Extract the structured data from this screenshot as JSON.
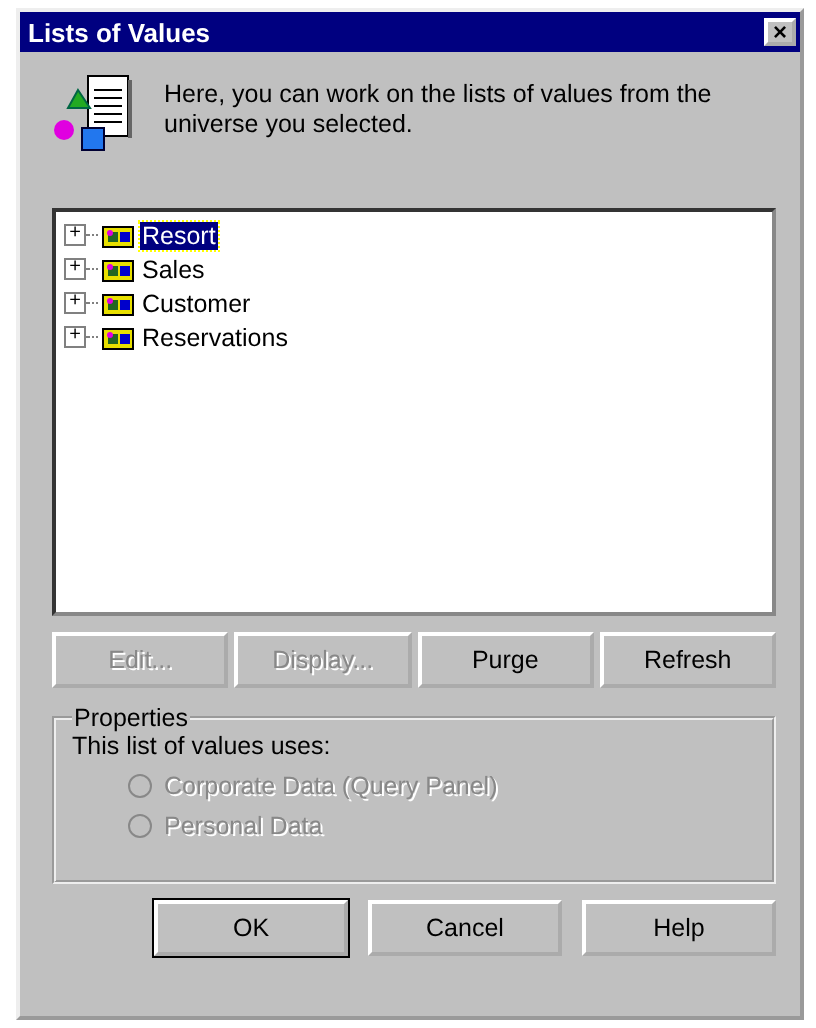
{
  "window": {
    "title": "Lists of Values",
    "close": "×"
  },
  "intro": "Here, you can work on the lists of values from the universe you selected.",
  "tree": [
    {
      "label": "Resort",
      "selected": true,
      "expanded": false,
      "toggle": "+"
    },
    {
      "label": "Sales",
      "selected": false,
      "expanded": false,
      "toggle": "+"
    },
    {
      "label": "Customer",
      "selected": false,
      "expanded": false,
      "toggle": "+"
    },
    {
      "label": "Reservations",
      "selected": false,
      "expanded": false,
      "toggle": "+"
    }
  ],
  "actions": [
    {
      "label": "Edit...",
      "disabled": true
    },
    {
      "label": "Display...",
      "disabled": true
    },
    {
      "label": "Purge",
      "disabled": false
    },
    {
      "label": "Refresh",
      "disabled": false
    }
  ],
  "properties": {
    "title": "Properties",
    "caption": "This list of values uses:",
    "options": [
      {
        "label": "Corporate Data (Query Panel)",
        "checked": false,
        "disabled": true
      },
      {
        "label": "Personal Data",
        "checked": false,
        "disabled": true
      }
    ]
  },
  "buttons": [
    {
      "label": "OK",
      "default": true
    },
    {
      "label": "Cancel",
      "default": false
    },
    {
      "label": "Help",
      "default": false
    }
  ]
}
